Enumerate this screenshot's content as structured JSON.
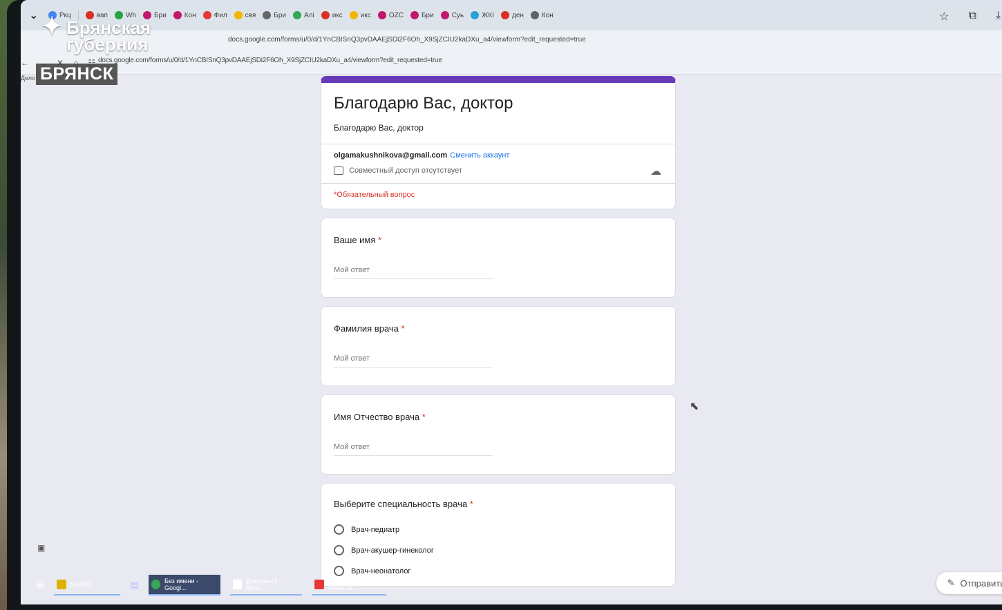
{
  "overlay": {
    "logo_line1": "Брянская",
    "logo_line2": "губерния",
    "city_badge": "БРЯНСК"
  },
  "browser": {
    "tabs": [
      "Ркц",
      "вап",
      "Wh",
      "Бри",
      "Кон",
      "Фил",
      "свя",
      "Бри",
      "Алі",
      "икс",
      "икс",
      "OZC",
      "Бри",
      "Суь",
      "ЖКІ",
      "ден",
      "Кон"
    ],
    "url": "docs.google.com/forms/u/0/d/1YnCBISnQ3pvDAAEjSDi2F6Oh_X9SjZCIU2kaDXu_a4/viewform?edit_requested=true",
    "url_top": "docs.google.com/forms/u/0/d/1YnCBISnQ3pvDAAEjSDi2F6Oh_X9SjZCIU2kaDXu_a4/viewform?edit_requested=true",
    "bookmark": "Дело"
  },
  "form": {
    "title": "Благодарю Вас, доктор",
    "description": "Благодарю Вас, доктор",
    "account_email": "olgamakushnikova@gmail.com",
    "switch_account": "Сменить аккаунт",
    "share_status": "Совместный доступ отсутствует",
    "required_note": "*Обязательный вопрос",
    "questions": [
      {
        "label": "Ваше имя",
        "placeholder": "Мой ответ"
      },
      {
        "label": "Фамилия врача",
        "placeholder": "Мой ответ"
      },
      {
        "label": "Имя Отчество врача",
        "placeholder": "Мой ответ"
      }
    ],
    "radio_question": {
      "label": "Выберите специальность врача",
      "options": [
        "Врач-педиатр",
        "Врач-акушер-гинеколог",
        "Врач-неонатолог"
      ]
    },
    "send_label": "Отправить"
  },
  "taskbar": {
    "items": [
      "SGON3",
      "Без имени - Googl...",
      "Документ1 - Micro...",
      "Фабрика Новосте..."
    ]
  }
}
